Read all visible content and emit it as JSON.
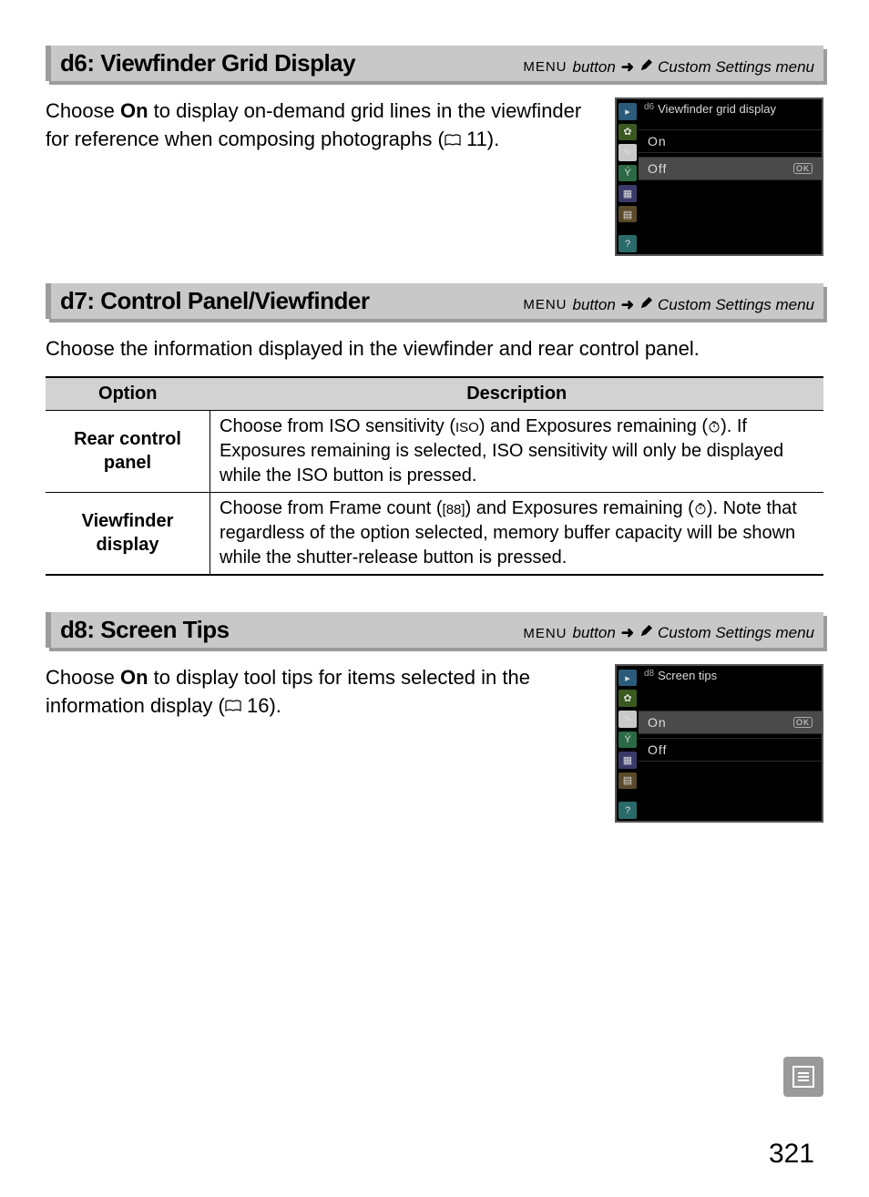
{
  "page_number": "321",
  "nav_path": {
    "menu_label": "MENU",
    "button_word": "button",
    "target": "Custom Settings menu"
  },
  "sections": {
    "d6": {
      "title": "d6: Viewfinder Grid Display",
      "body_prefix": "Choose ",
      "body_bold1": "On",
      "body_after1": " to display on-demand grid lines in the viewfinder for reference when composing photographs (",
      "book_ref": "11",
      "body_tail": ").",
      "lcd": {
        "title_prefix": "d6",
        "title": "Viewfinder grid display",
        "opt_on": "On",
        "opt_off": "Off",
        "selected": "Off"
      }
    },
    "d7": {
      "title": "d7: Control Panel/Viewfinder",
      "body": "Choose the information displayed in the viewfinder and rear control panel.",
      "table": {
        "head_option": "Option",
        "head_desc": "Description",
        "rows": [
          {
            "option_line1": "Rear control",
            "option_line2": "panel",
            "desc_parts": [
              "Choose from ",
              "ISO sensitivity",
              " (",
              "ISO",
              ") and ",
              "Exposures remaining",
              " (",
              "timer",
              "). If ",
              "Exposures remaining",
              " is selected, ISO sensitivity will only be displayed while the ",
              "ISO",
              " button is pressed."
            ]
          },
          {
            "option_line1": "Viewfinder",
            "option_line2": "display",
            "desc_parts": [
              "Choose from ",
              "Frame count",
              " (",
              "[88]",
              ") and ",
              "Exposures remaining",
              " (",
              "timer",
              ").  Note that regardless of the option selected, memory buffer capacity will be shown while the shutter-release button is pressed."
            ]
          }
        ]
      }
    },
    "d8": {
      "title": "d8: Screen Tips",
      "body_prefix": "Choose ",
      "body_bold1": "On",
      "body_after1": " to display tool tips for items selected in the information display (",
      "book_ref": "16",
      "body_tail": ").",
      "lcd": {
        "title_prefix": "d8",
        "title": "Screen tips",
        "opt_on": "On",
        "opt_off": "Off",
        "selected": "On"
      }
    }
  }
}
